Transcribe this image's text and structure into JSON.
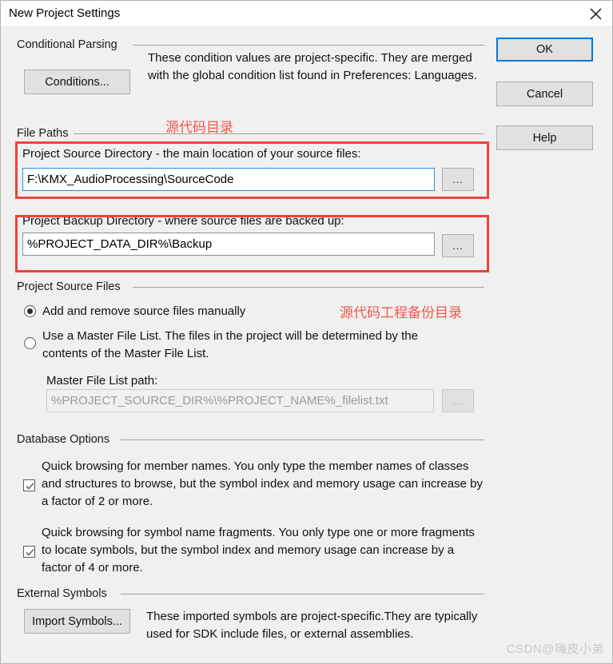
{
  "window": {
    "title": "New Project Settings",
    "close_icon": "close-icon"
  },
  "buttons": {
    "ok": "OK",
    "cancel": "Cancel",
    "help": "Help"
  },
  "conditional_parsing": {
    "group_label": "Conditional Parsing",
    "conditions_button": "Conditions...",
    "description": "These condition values are project-specific.  They are merged with the global condition list found in Preferences: Languages."
  },
  "file_paths": {
    "group_label": "File Paths",
    "source": {
      "label": "Project Source Directory - the main location of your source files:",
      "value": "F:\\KMX_AudioProcessing\\SourceCode",
      "browse_button": "..."
    },
    "backup": {
      "label": "Project Backup Directory - where source files are backed up:",
      "value": "%PROJECT_DATA_DIR%\\Backup",
      "browse_button": "..."
    }
  },
  "project_source_files": {
    "group_label": "Project Source Files",
    "radio_manual": "Add and remove source files manually",
    "radio_master": "Use a Master File List. The files in the project will be determined by the contents of the Master File List.",
    "master_path_label": "Master File List path:",
    "master_path_value": "%PROJECT_SOURCE_DIR%\\%PROJECT_NAME%_filelist.txt",
    "master_browse_button": "..."
  },
  "database_options": {
    "group_label": "Database Options",
    "option1": "Quick browsing for member names.  You only type the member names of classes and structures to browse, but the symbol index and memory usage can increase by a factor of 2 or more.",
    "option2": "Quick browsing for symbol name fragments.  You only type one or more fragments to locate symbols, but the symbol index and memory usage can increase by a factor of 4 or more."
  },
  "external_symbols": {
    "group_label": "External Symbols",
    "import_button": "Import Symbols...",
    "description": "These imported symbols are project-specific.They are typically used for SDK include files, or external assemblies."
  },
  "annotations": {
    "source_dir_note": "源代码目录",
    "backup_dir_note": "源代码工程备份目录"
  },
  "watermark": "CSDN@嗨皮小弟",
  "colors": {
    "accent": "#0078d7",
    "annotation_red": "#f0433a",
    "dialog_bg": "#f0f0f0"
  }
}
